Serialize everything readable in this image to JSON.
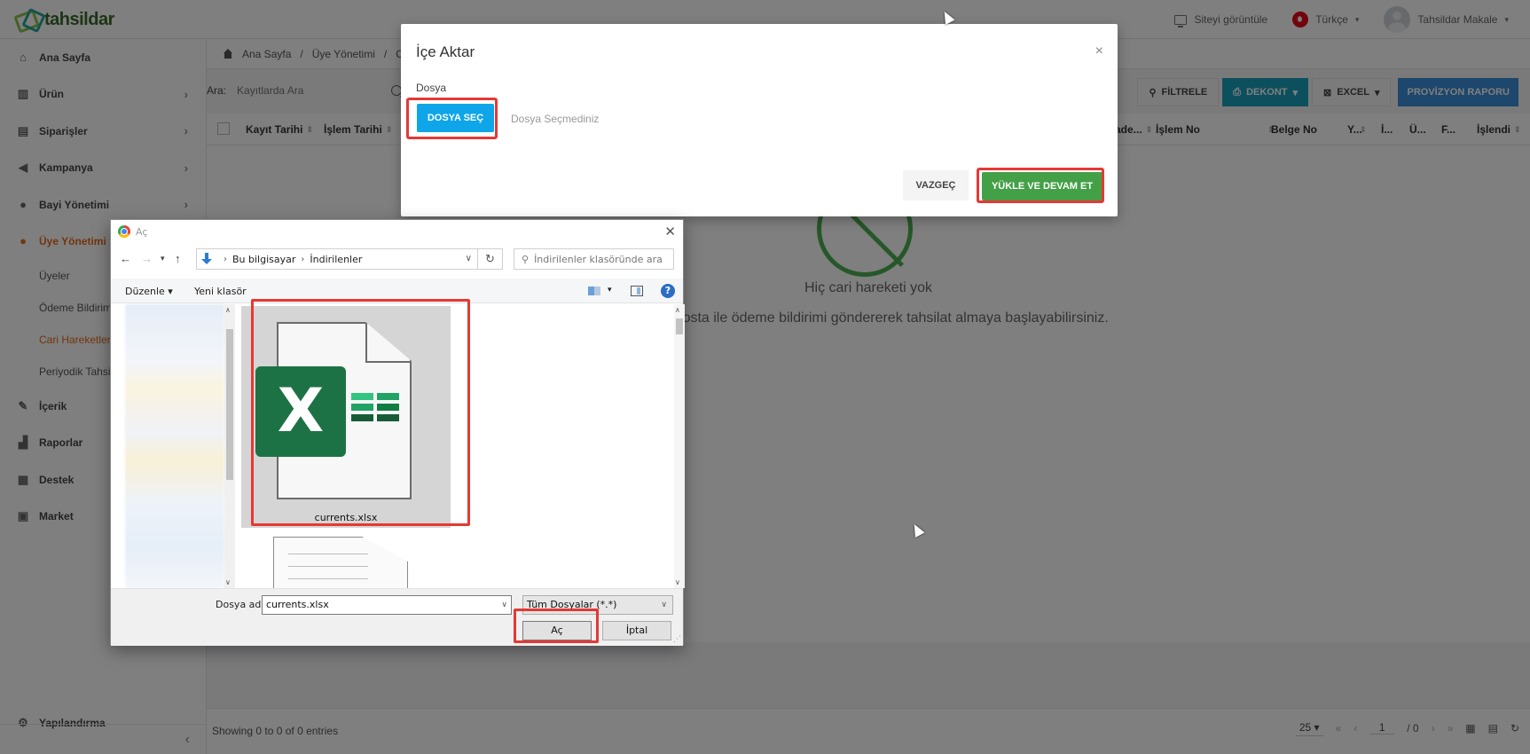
{
  "app": {
    "logo_text": "tahsildar",
    "site_link": "Siteyi görüntüle",
    "language": "Türkçe",
    "user_name": "Tahsildar Makale"
  },
  "sidebar": {
    "items": [
      {
        "label": "Ana Sayfa",
        "icon": "home-icon"
      },
      {
        "label": "Ürün",
        "icon": "bank-icon"
      },
      {
        "label": "Siparişler",
        "icon": "store-icon"
      },
      {
        "label": "Kampanya",
        "icon": "megaphone-icon"
      },
      {
        "label": "Bayi Yönetimi",
        "icon": "dealer-icon"
      },
      {
        "label": "Üye Yönetimi",
        "icon": "member-icon"
      }
    ],
    "sub_items": [
      {
        "label": "Üyeler"
      },
      {
        "label": "Ödeme Bildirim"
      },
      {
        "label": "Cari Hareketler"
      },
      {
        "label": "Periyodik Tahsi"
      }
    ],
    "items2": [
      {
        "label": "İçerik",
        "icon": "content-icon"
      },
      {
        "label": "Raporlar",
        "icon": "chart-icon"
      },
      {
        "label": "Destek",
        "icon": "support-icon"
      },
      {
        "label": "Market",
        "icon": "market-icon"
      }
    ],
    "config": {
      "label": "Yapılandırma",
      "icon": "settings-icon"
    }
  },
  "breadcrumb": {
    "home": "Ana Sayfa",
    "sep": "/",
    "level2": "Üye Yönetimi",
    "level3": "Cari"
  },
  "toolbar": {
    "search_label": "Ara:",
    "search_placeholder": "Kayıtlarda Ara",
    "filter": "FİLTRELE",
    "dekont": "DEKONT",
    "excel": "EXCEL",
    "provizyon": "PROVİZYON RAPORU"
  },
  "table": {
    "headers": [
      "Kayıt Tarihi",
      "İşlem Tarihi",
      "...ade...",
      "İşlem No",
      "Belge No",
      "Y...",
      "İ...",
      "Ü...",
      "F...",
      "İşlendi"
    ]
  },
  "empty_state": {
    "title": "Hiç cari hareketi yok",
    "subtitle": "...ize e-posta ile ödeme bildirimi göndererek tahsilat almaya başlayabilirsiniz."
  },
  "footer": {
    "info": "Showing 0 to 0 of 0 entries",
    "page_size": "25",
    "page": "1",
    "of_pages": "/ 0"
  },
  "import_modal": {
    "title": "İçe Aktar",
    "close": "×",
    "file_label": "Dosya",
    "choose_button": "DOSYA SEÇ",
    "no_file_text": "Dosya Seçmediniz",
    "cancel_button": "VAZGEÇ",
    "upload_button": "YÜKLE VE DEVAM ET"
  },
  "file_dialog": {
    "title": "Aç",
    "address": {
      "root": "Bu bilgisayar",
      "folder": "İndirilenler"
    },
    "search_placeholder": "İndirilenler klasöründe ara",
    "organize": "Düzenle",
    "new_folder": "Yeni klasör",
    "help": "?",
    "selected_file": "currents.xlsx",
    "file_name_label": "Dosya adı:",
    "file_name_value": "currents.xlsx",
    "file_type": "Tüm Dosyalar (*.*)",
    "open_button": "Aç",
    "cancel_button": "İptal",
    "excel_letter": "X"
  }
}
